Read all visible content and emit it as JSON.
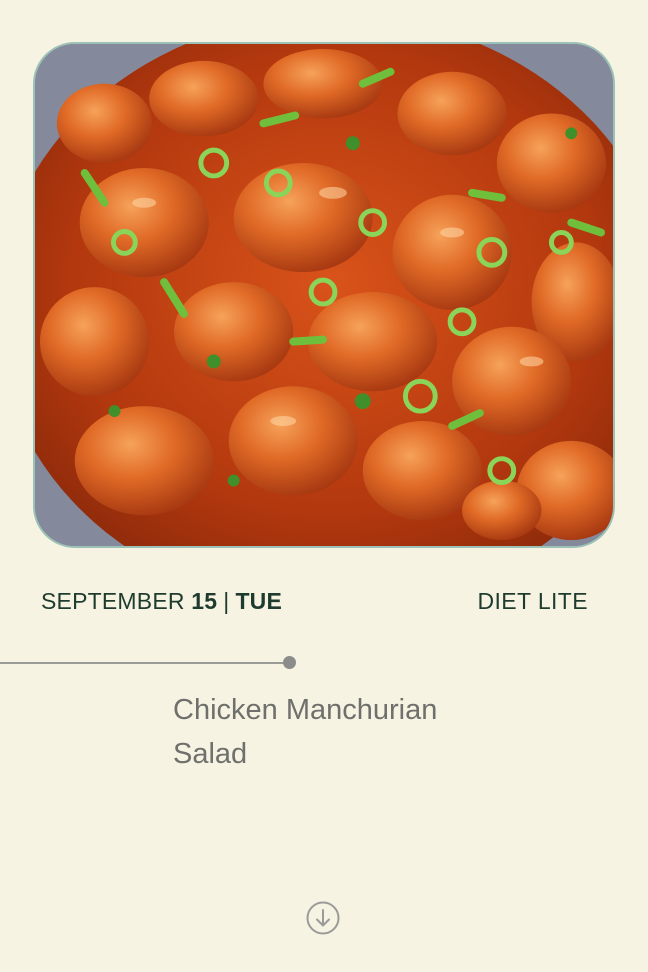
{
  "hero": {
    "image_alt": "Chicken Manchurian dish garnished with spring onions and coriander",
    "icon": "food-photo"
  },
  "date": {
    "month": "SEPTEMBER",
    "day": "15",
    "separator": "|",
    "weekday": "TUE"
  },
  "plan": {
    "label": "DIET LITE"
  },
  "meal": {
    "title": "Chicken Manchurian Salad"
  },
  "scroll": {
    "icon": "arrow-down-circle-icon"
  },
  "colors": {
    "background": "#f6f3e2",
    "text_dark": "#1f3b2e",
    "text_muted": "#6f6f6c",
    "card_border": "#9cc1b7"
  }
}
